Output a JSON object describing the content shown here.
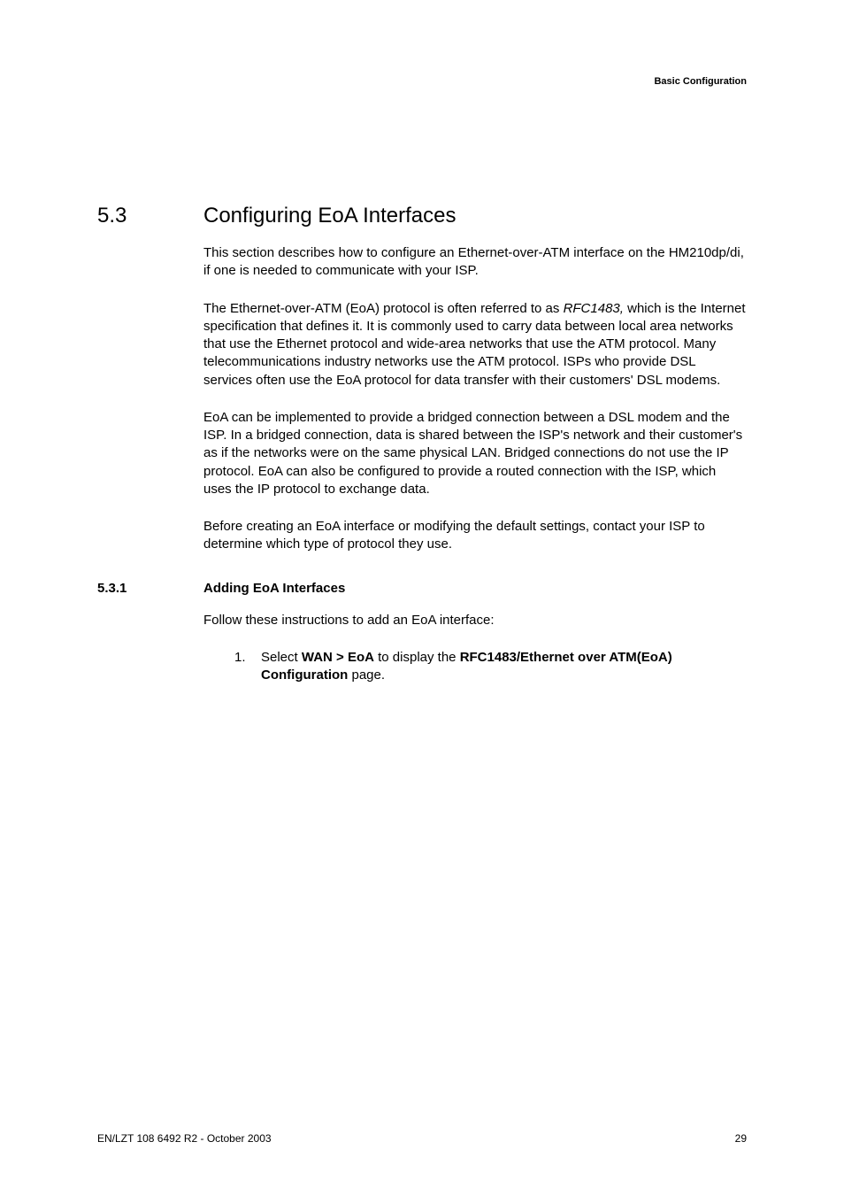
{
  "header": {
    "label": "Basic Configuration"
  },
  "section": {
    "number": "5.3",
    "title": "Configuring EoA Interfaces"
  },
  "paragraphs": {
    "p1": "This section describes how to configure an Ethernet-over-ATM interface on the HM210dp/di, if one is needed to communicate with your ISP.",
    "p2_part1": "The Ethernet-over-ATM (EoA) protocol is often referred to as ",
    "p2_italic": "RFC1483,",
    "p2_part2": " which is the Internet specification that defines it. It is commonly used to carry data between local area networks that use the Ethernet protocol and wide-area networks that use the ATM protocol. Many telecommunications industry networks use the ATM protocol. ISPs who provide DSL services often use the EoA protocol for data transfer with their customers' DSL modems.",
    "p3": "EoA can be implemented to provide a bridged connection between a DSL modem and the ISP. In a bridged connection, data is shared between the ISP's network and their customer's as if the networks were on the same physical LAN. Bridged connections do not use the IP protocol. EoA can also be configured to provide a routed connection with the ISP, which uses the IP protocol to exchange data.",
    "p4": "Before creating an EoA interface or modifying the default settings, contact your ISP to determine which type of protocol they use."
  },
  "subsection": {
    "number": "5.3.1",
    "title": "Adding EoA Interfaces"
  },
  "subsection_intro": "Follow these instructions to add an EoA interface:",
  "list": {
    "item1": {
      "marker": "1.",
      "text_a": "Select ",
      "bold_a": "WAN > EoA",
      "text_b": " to display the ",
      "bold_b": "RFC1483/Ethernet over ATM(EoA) Configuration",
      "text_c": " page."
    }
  },
  "footer": {
    "left": "EN/LZT 108 6492 R2 - October 2003",
    "right": "29"
  }
}
